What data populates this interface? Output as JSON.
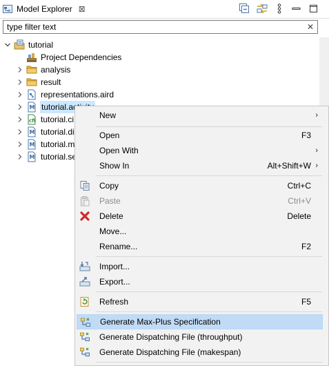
{
  "view": {
    "title": "Model Explorer",
    "close_glyph": "⊠",
    "toolbar": [
      {
        "name": "collapse-all-icon"
      },
      {
        "name": "link-with-editor-icon"
      },
      {
        "name": "view-menu-icon"
      },
      {
        "name": "minimize-icon"
      },
      {
        "name": "maximize-icon"
      }
    ]
  },
  "filter": {
    "placeholder": "type filter text",
    "clear_glyph": "✕"
  },
  "tree": {
    "root": {
      "label": "tutorial",
      "icon": "modeling-project-icon"
    },
    "items": [
      {
        "label": "Project Dependencies",
        "icon": "project-dependencies-icon",
        "twisty": ""
      },
      {
        "label": "analysis",
        "icon": "folder-icon",
        "twisty": "›"
      },
      {
        "label": "result",
        "icon": "folder-icon",
        "twisty": "›"
      },
      {
        "label": "representations.aird",
        "icon": "aird-file-icon",
        "twisty": "›"
      },
      {
        "label": "tutorial.activity",
        "icon": "model-file-icon",
        "twisty": "›"
      },
      {
        "label": "tutorial.ci",
        "icon": "model-file-icon",
        "twisty": "›"
      },
      {
        "label": "tutorial.di",
        "icon": "model-file-icon",
        "twisty": "›"
      },
      {
        "label": "tutorial.m",
        "icon": "model-file-icon",
        "twisty": "›"
      },
      {
        "label": "tutorial.se",
        "icon": "model-file-icon",
        "twisty": "›"
      }
    ]
  },
  "context_menu": {
    "items": [
      {
        "label": "New",
        "shortcut": "",
        "submenu": "›",
        "icon": ""
      },
      {
        "label": "Open",
        "shortcut": "F3",
        "submenu": "",
        "icon": ""
      },
      {
        "label": "Open With",
        "shortcut": "",
        "submenu": "›",
        "icon": ""
      },
      {
        "label": "Show In",
        "shortcut": "Alt+Shift+W",
        "submenu": "›",
        "icon": ""
      },
      {
        "label": "Copy",
        "shortcut": "Ctrl+C",
        "submenu": "",
        "icon": "copy-icon"
      },
      {
        "label": "Paste",
        "shortcut": "Ctrl+V",
        "submenu": "",
        "icon": "paste-icon",
        "disabled": true
      },
      {
        "label": "Delete",
        "shortcut": "Delete",
        "submenu": "",
        "icon": "delete-icon"
      },
      {
        "label": "Move...",
        "shortcut": "",
        "submenu": "",
        "icon": ""
      },
      {
        "label": "Rename...",
        "shortcut": "F2",
        "submenu": "",
        "icon": ""
      },
      {
        "label": "Import...",
        "shortcut": "",
        "submenu": "",
        "icon": "import-icon"
      },
      {
        "label": "Export...",
        "shortcut": "",
        "submenu": "",
        "icon": "export-icon"
      },
      {
        "label": "Refresh",
        "shortcut": "F5",
        "submenu": "",
        "icon": "refresh-icon"
      },
      {
        "label": "Generate Max-Plus Specification",
        "shortcut": "",
        "submenu": "",
        "icon": "generate-icon",
        "highlighted": true
      },
      {
        "label": "Generate Dispatching File (throughput)",
        "shortcut": "",
        "submenu": "",
        "icon": "generate-icon"
      },
      {
        "label": "Generate Dispatching File (makespan)",
        "shortcut": "",
        "submenu": "",
        "icon": "generate-icon"
      }
    ]
  },
  "colors": {
    "selection": "#cce8ff",
    "menu_background": "#f2f2f2",
    "menu_highlight": "#c1dbf6",
    "delete_red": "#d4262b",
    "folder_yellow": "#e8b84a"
  }
}
